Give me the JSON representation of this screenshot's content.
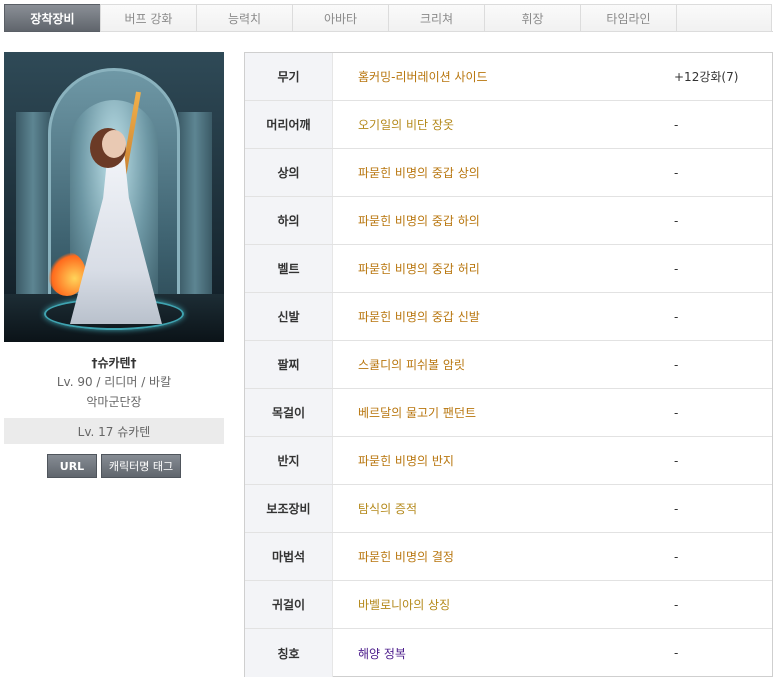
{
  "tabs": [
    {
      "label": "장착장비",
      "active": true
    },
    {
      "label": "버프 강화"
    },
    {
      "label": "능력치"
    },
    {
      "label": "아바타"
    },
    {
      "label": "크리쳐"
    },
    {
      "label": "휘장"
    },
    {
      "label": "타임라인"
    },
    {
      "label": ""
    }
  ],
  "profile": {
    "name": "†슈카텐†",
    "info": "Lv. 90 / 리디머 / 바칼",
    "guild": "악마군단장",
    "adventure": "Lv. 17 슈카텐",
    "url_button": "URL",
    "tag_button": "캐릭터명 태그"
  },
  "colors": {
    "unique": "#b4891b",
    "legendary": "#b8760e",
    "title": "#4a1a8a",
    "tab_active": "#60656c"
  },
  "equipment": [
    {
      "slot": "무기",
      "item": "홈커밍-리버레이션 사이드",
      "extra": "+12강화(7)",
      "rarity": "legendary"
    },
    {
      "slot": "머리어깨",
      "item": "오기일의 비단 장옷",
      "extra": "-",
      "rarity": "unique"
    },
    {
      "slot": "상의",
      "item": "파묻힌 비명의 중갑 상의",
      "extra": "-",
      "rarity": "legendary"
    },
    {
      "slot": "하의",
      "item": "파묻힌 비명의 중갑 하의",
      "extra": "-",
      "rarity": "legendary"
    },
    {
      "slot": "벨트",
      "item": "파묻힌 비명의 중갑 허리",
      "extra": "-",
      "rarity": "legendary"
    },
    {
      "slot": "신발",
      "item": "파묻힌 비명의 중갑 신발",
      "extra": "-",
      "rarity": "legendary"
    },
    {
      "slot": "팔찌",
      "item": "스쿨디의 피쉬볼 암릿",
      "extra": "-",
      "rarity": "legendary"
    },
    {
      "slot": "목걸이",
      "item": "베르달의 물고기 팬던트",
      "extra": "-",
      "rarity": "legendary"
    },
    {
      "slot": "반지",
      "item": "파묻힌 비명의 반지",
      "extra": "-",
      "rarity": "legendary"
    },
    {
      "slot": "보조장비",
      "item": "탐식의 증적",
      "extra": "-",
      "rarity": "unique"
    },
    {
      "slot": "마법석",
      "item": "파묻힌 비명의 결정",
      "extra": "-",
      "rarity": "legendary"
    },
    {
      "slot": "귀걸이",
      "item": "바벨로니아의 상징",
      "extra": "-",
      "rarity": "unique"
    },
    {
      "slot": "칭호",
      "item": "해양 정복",
      "extra": "-",
      "rarity": "title"
    }
  ]
}
